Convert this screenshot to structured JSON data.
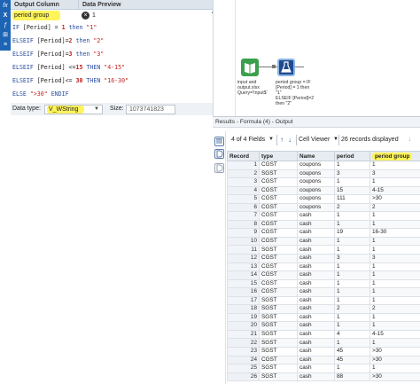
{
  "formula_panel": {
    "col_output": "Output Column",
    "col_preview": "Data Preview",
    "field_name": "period group",
    "preview_value": "1",
    "formula_lines": [
      [
        {
          "t": "kw",
          "v": "IF "
        },
        {
          "t": "fld",
          "v": "[Period]"
        },
        {
          "t": "op",
          "v": " = "
        },
        {
          "t": "num",
          "v": "1"
        },
        {
          "t": "kw",
          "v": " then "
        },
        {
          "t": "str",
          "v": "\"1\""
        }
      ],
      [
        {
          "t": "kw",
          "v": "ELSEIF "
        },
        {
          "t": "fld",
          "v": "[Period]"
        },
        {
          "t": "op",
          "v": "="
        },
        {
          "t": "num",
          "v": "2"
        },
        {
          "t": "kw",
          "v": " then "
        },
        {
          "t": "str",
          "v": "\"2\""
        }
      ],
      [
        {
          "t": "kw",
          "v": "ELSEIF "
        },
        {
          "t": "fld",
          "v": "[Period]"
        },
        {
          "t": "op",
          "v": "="
        },
        {
          "t": "num",
          "v": "3"
        },
        {
          "t": "kw",
          "v": " then "
        },
        {
          "t": "str",
          "v": "\"3\""
        }
      ],
      [
        {
          "t": "kw",
          "v": "ELSEIF "
        },
        {
          "t": "fld",
          "v": "[Period]"
        },
        {
          "t": "op",
          "v": " <="
        },
        {
          "t": "num",
          "v": "15"
        },
        {
          "t": "kw",
          "v": " THEN "
        },
        {
          "t": "str",
          "v": "\"4-15\""
        }
      ],
      [
        {
          "t": "kw",
          "v": "ELSEIF "
        },
        {
          "t": "fld",
          "v": "[Period]"
        },
        {
          "t": "op",
          "v": "<= "
        },
        {
          "t": "num",
          "v": "30"
        },
        {
          "t": "kw",
          "v": " THEN "
        },
        {
          "t": "str",
          "v": "\"16-30\""
        }
      ],
      [
        {
          "t": "kw",
          "v": "ELSE "
        },
        {
          "t": "str",
          "v": "\">30\""
        },
        {
          "t": "kw",
          "v": " ENDIF"
        }
      ]
    ],
    "data_type_label": "Data type:",
    "data_type_value": "V_WString",
    "size_label": "Size:",
    "size_value": "1073741823"
  },
  "canvas": {
    "input_caption": "input and\noutput.xlsx\nQuery='Input$'",
    "formula_caption": "period group = IF\n[Period] = 1 then\n\"1\"\nELSEIF [Period]=2\nthen \"2\""
  },
  "results": {
    "title": "Results - Formula (4) - Output",
    "fields_count": "4 of 4 Fields",
    "cell_viewer": "Cell Viewer",
    "records_displayed": "26 records displayed",
    "columns": [
      "Record",
      "type",
      "Name",
      "period",
      "period group"
    ],
    "rows": [
      [
        "1",
        "CGST",
        "coupons",
        "1",
        "1"
      ],
      [
        "2",
        "SGST",
        "coupons",
        "3",
        "3"
      ],
      [
        "3",
        "CGST",
        "coupons",
        "1",
        "1"
      ],
      [
        "4",
        "CGST",
        "coupons",
        "15",
        "4-15"
      ],
      [
        "5",
        "CGST",
        "coupons",
        "111",
        ">30"
      ],
      [
        "6",
        "CGST",
        "coupons",
        "2",
        "2"
      ],
      [
        "7",
        "CGST",
        "cash",
        "1",
        "1"
      ],
      [
        "8",
        "CGST",
        "cash",
        "1",
        "1"
      ],
      [
        "9",
        "CGST",
        "cash",
        "19",
        "16-30"
      ],
      [
        "10",
        "CGST",
        "cash",
        "1",
        "1"
      ],
      [
        "11",
        "SGST",
        "cash",
        "1",
        "1"
      ],
      [
        "12",
        "CGST",
        "cash",
        "3",
        "3"
      ],
      [
        "13",
        "CGST",
        "cash",
        "1",
        "1"
      ],
      [
        "14",
        "CGST",
        "cash",
        "1",
        "1"
      ],
      [
        "15",
        "CGST",
        "cash",
        "1",
        "1"
      ],
      [
        "16",
        "CGST",
        "cash",
        "1",
        "1"
      ],
      [
        "17",
        "SGST",
        "cash",
        "1",
        "1"
      ],
      [
        "18",
        "SGST",
        "cash",
        "2",
        "2"
      ],
      [
        "19",
        "SGST",
        "cash",
        "1",
        "1"
      ],
      [
        "20",
        "SGST",
        "cash",
        "1",
        "1"
      ],
      [
        "21",
        "SGST",
        "cash",
        "4",
        "4-15"
      ],
      [
        "22",
        "SGST",
        "cash",
        "1",
        "1"
      ],
      [
        "23",
        "SGST",
        "cash",
        "45",
        ">30"
      ],
      [
        "24",
        "CGST",
        "cash",
        "45",
        ">30"
      ],
      [
        "25",
        "SGST",
        "cash",
        "1",
        "1"
      ],
      [
        "26",
        "SGST",
        "cash",
        "88",
        ">30"
      ]
    ]
  },
  "colors": {
    "highlight": "#fff45a",
    "toolbar_blue": "#1e64b4",
    "keyword": "#2c4e9e",
    "string_literal": "#c32121"
  },
  "icons": [
    "fx-icon",
    "x-icon",
    "function-icon",
    "variable-icon",
    "clear-icon",
    "trash-icon",
    "book-icon",
    "flask-icon",
    "table-icon",
    "side-d-icon",
    "chevron-up-icon",
    "chevron-down-icon"
  ]
}
